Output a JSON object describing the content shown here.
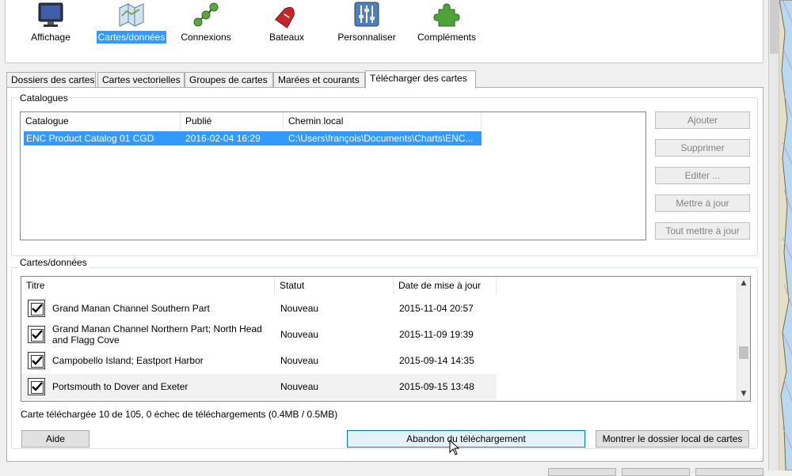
{
  "toolbar": {
    "items": [
      {
        "label": "Affichage",
        "icon": "monitor-icon"
      },
      {
        "label": "Cartes/données",
        "icon": "charts-icon",
        "selected": true
      },
      {
        "label": "Connexions",
        "icon": "connections-icon"
      },
      {
        "label": "Bateaux",
        "icon": "boat-icon"
      },
      {
        "label": "Personnaliser",
        "icon": "sliders-icon"
      },
      {
        "label": "Compléments",
        "icon": "puzzle-icon"
      }
    ]
  },
  "tabs": [
    {
      "label": "Dossiers des cartes"
    },
    {
      "label": "Cartes vectorielles"
    },
    {
      "label": "Groupes de cartes"
    },
    {
      "label": "Marées et courants"
    },
    {
      "label": "Télécharger des cartes",
      "active": true
    }
  ],
  "catalogues": {
    "legend": "Catalogues",
    "columns": [
      "Catalogue",
      "Publié",
      "Chemin local"
    ],
    "rows": [
      {
        "catalogue": "ENC Product Catalog 01 CGD",
        "published": "2016-02-04 16:29",
        "path": "C:\\Users\\françois\\Documents\\Charts\\ENC...",
        "selected": true
      }
    ],
    "buttons": {
      "add": "Ajouter",
      "remove": "Supprimer",
      "edit": "Editer ...",
      "update": "Mettre à jour",
      "update_all": "Tout mettre à jour"
    }
  },
  "charts": {
    "legend": "Cartes/données",
    "columns": [
      "Titre",
      "Statut",
      "Date de mise à jour"
    ],
    "rows": [
      {
        "title": "Grand Manan Channel Southern Part",
        "status": "Nouveau",
        "date": "2015-11-04 20:57",
        "checked": true
      },
      {
        "title": "Grand Manan Channel Northern Part; North Head and Flagg Cove",
        "status": "Nouveau",
        "date": "2015-11-09 19:39",
        "checked": true
      },
      {
        "title": "Campobello Island; Eastport Harbor",
        "status": "Nouveau",
        "date": "2015-09-14 14:35",
        "checked": true
      },
      {
        "title": "Portsmouth to Dover and Exeter",
        "status": "Nouveau",
        "date": "2015-09-15 13:48",
        "checked": true
      }
    ]
  },
  "status": "Carte téléchargée 10 de 105, 0 échec de téléchargements (0.4MB / 0.5MB)",
  "footer": {
    "help": "Aide",
    "abort": "Abandon du téléchargement",
    "show_folder": "Montrer le dossier local de cartes"
  },
  "colors": {
    "selection": "#3399ff",
    "chart_land": "#e6dfc8",
    "chart_water": "#b7d9f2"
  }
}
